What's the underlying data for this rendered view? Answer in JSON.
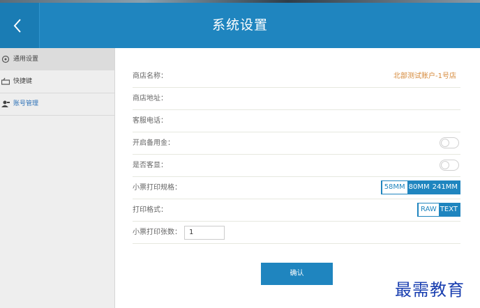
{
  "header": {
    "title": "系统设置"
  },
  "sidebar": {
    "items": [
      {
        "label": "通用设置"
      },
      {
        "label": "快捷键"
      },
      {
        "label": "账号管理"
      }
    ]
  },
  "form": {
    "shop_name_label": "商店名称：",
    "shop_name_value": "北部测试账户-1号店",
    "shop_address_label": "商店地址：",
    "service_phone_label": "客服电话：",
    "reserve_fund_label": "开启备用金：",
    "customer_display_label": "是否客显：",
    "receipt_spec_label": "小票打印规格：",
    "receipt_spec_options": [
      "58MM",
      "80MM",
      "241MM"
    ],
    "print_format_label": "打印格式：",
    "print_format_options": [
      "RAW",
      "TEXT"
    ],
    "copies_label": "小票打印张数：",
    "copies_value": "1",
    "confirm_label": "确认"
  },
  "watermark": {
    "text": "最需教育"
  }
}
